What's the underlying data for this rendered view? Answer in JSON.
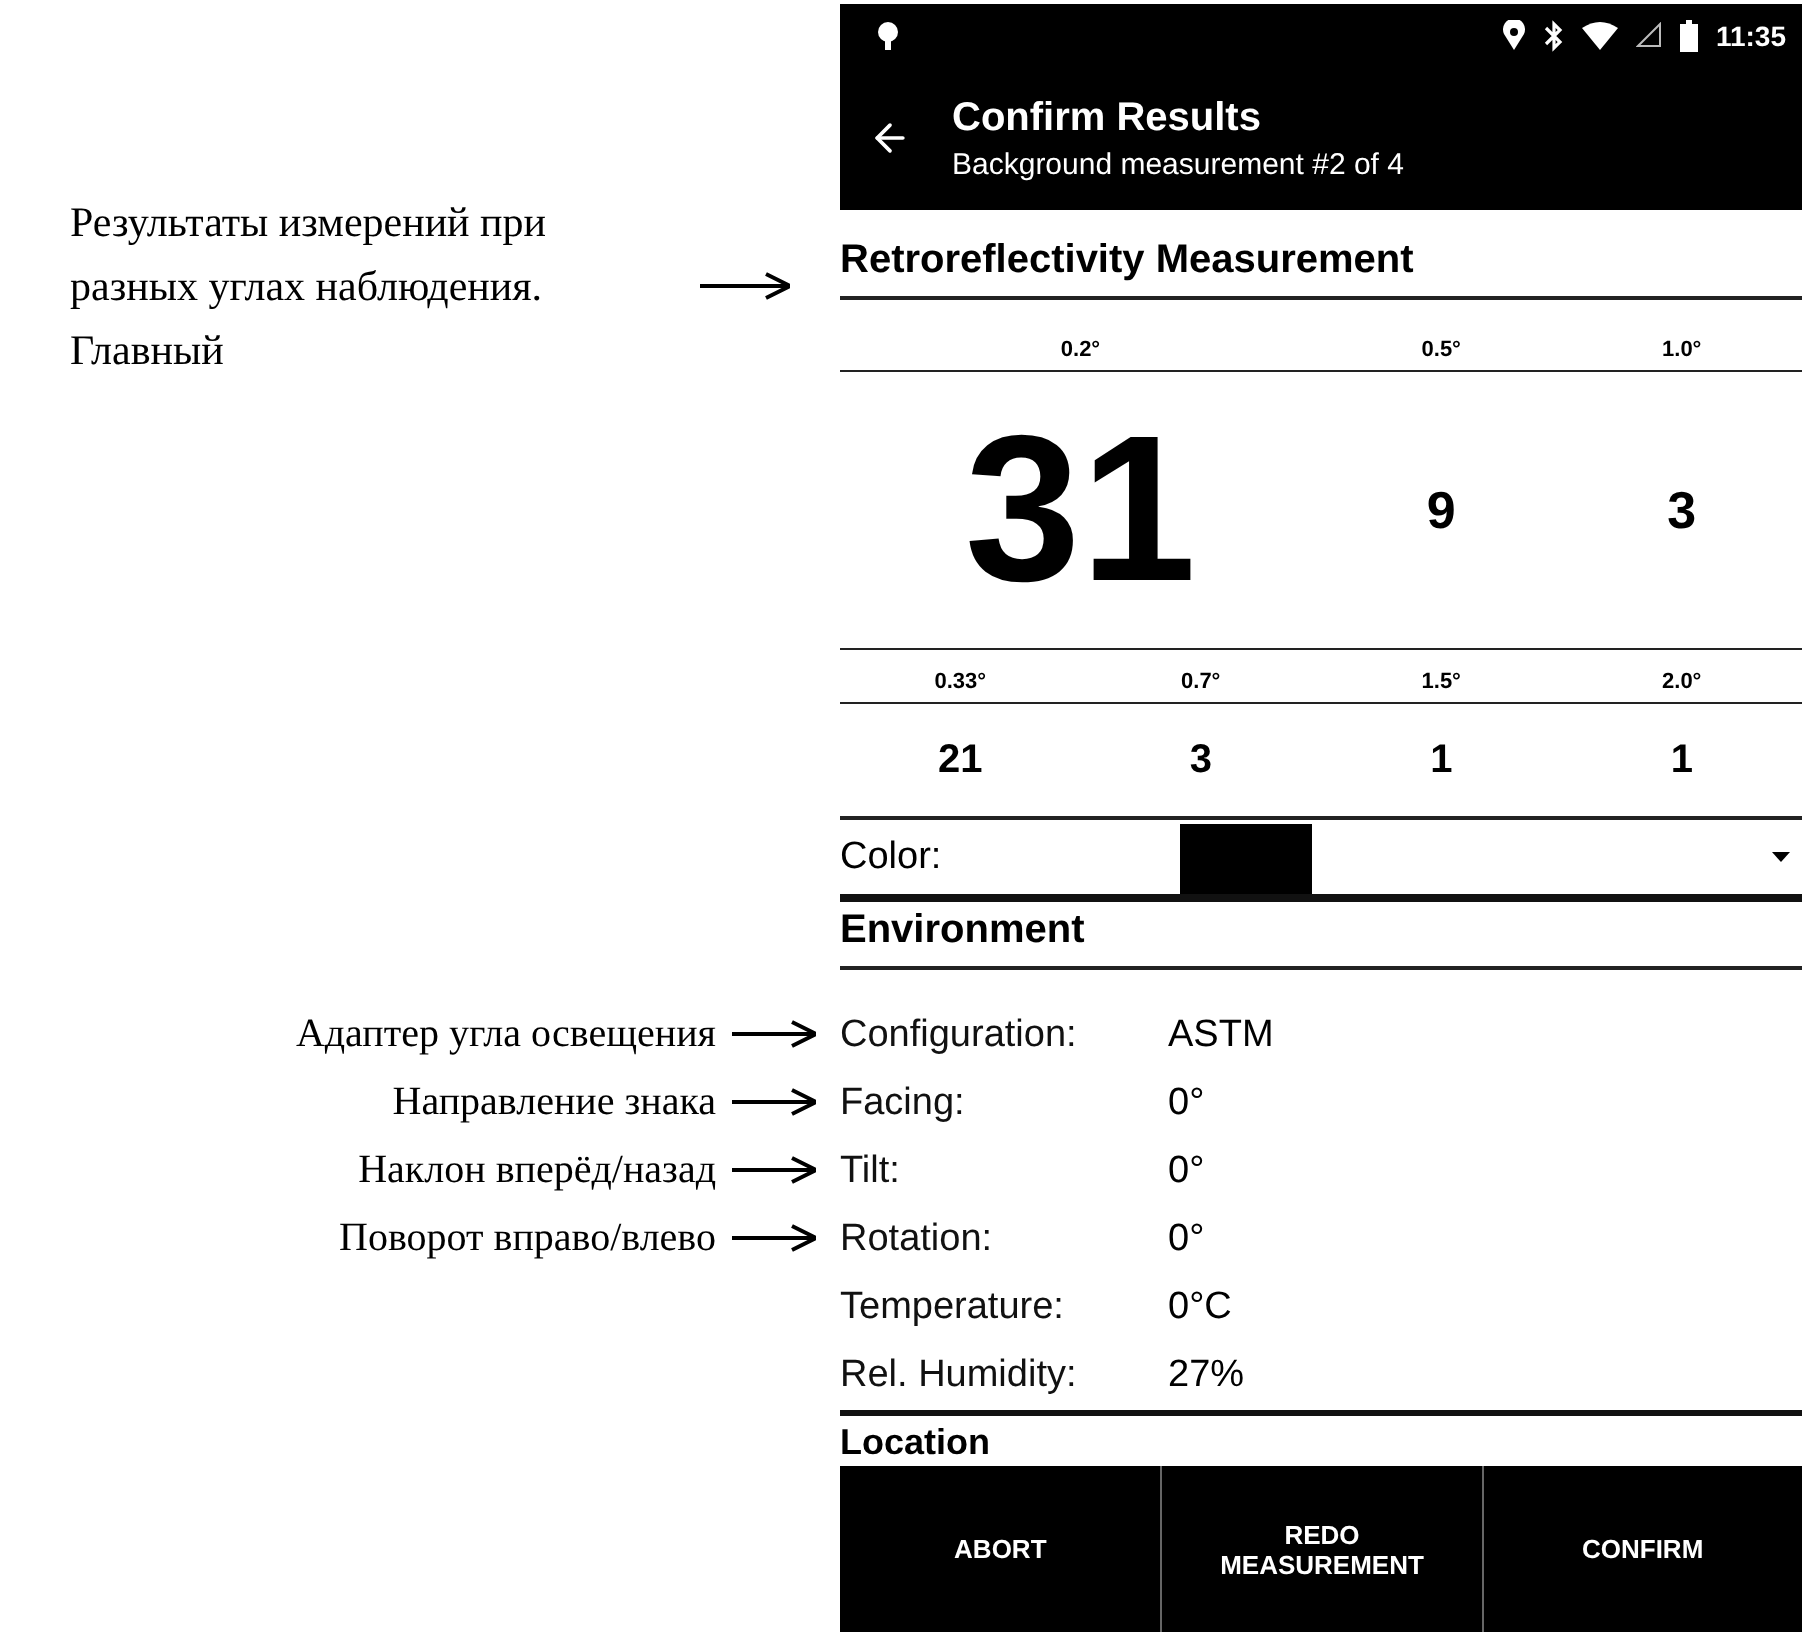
{
  "annotations": {
    "results_note": "Результаты измерений при разных углах наблюдения. Главный",
    "field_notes": [
      {
        "text": "Адаптер угла освещения"
      },
      {
        "text": "Направление знака"
      },
      {
        "text": "Наклон вперёд/назад"
      },
      {
        "text": "Поворот вправо/влево"
      }
    ]
  },
  "status_bar": {
    "time": "11:35"
  },
  "app_bar": {
    "title": "Confirm Results",
    "subtitle": "Background measurement #2 of 4"
  },
  "retroreflectivity": {
    "heading": "Retroreflectivity Measurement",
    "primary_row": [
      {
        "angle": "0.2°",
        "value": "31",
        "kind": "main"
      },
      {
        "angle": "0.5°",
        "value": "9",
        "kind": "minor"
      },
      {
        "angle": "1.0°",
        "value": "3",
        "kind": "minor"
      }
    ],
    "secondary_row": [
      {
        "angle": "0.33°",
        "value": "21"
      },
      {
        "angle": "0.7°",
        "value": "3"
      },
      {
        "angle": "1.5°",
        "value": "1"
      },
      {
        "angle": "2.0°",
        "value": "1"
      }
    ],
    "color": {
      "label": "Color:",
      "color": "#000000"
    }
  },
  "environment": {
    "heading": "Environment",
    "rows": [
      {
        "label": "Configuration:",
        "value": "ASTM"
      },
      {
        "label": "Facing:",
        "value": "0°"
      },
      {
        "label": "Tilt:",
        "value": "0°"
      },
      {
        "label": "Rotation:",
        "value": "0°"
      },
      {
        "label": "Temperature:",
        "value": "0°C"
      },
      {
        "label": "Rel. Humidity:",
        "value": "27%"
      }
    ]
  },
  "location": {
    "heading": "Location"
  },
  "actions": [
    "ABORT",
    "REDO MEASUREMENT",
    "CONFIRM"
  ]
}
